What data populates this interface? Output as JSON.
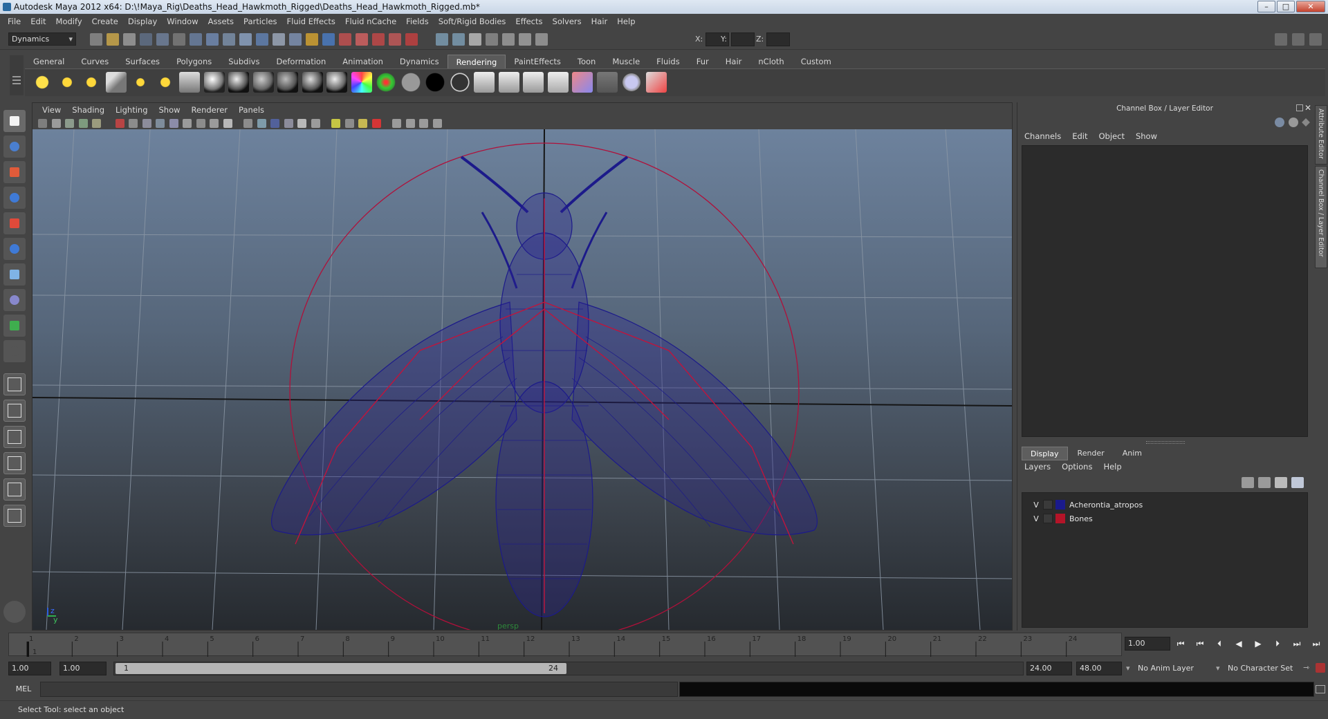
{
  "window": {
    "title": "Autodesk Maya 2012 x64: D:\\!Maya_Rig\\Deaths_Head_Hawkmoth_Rigged\\Deaths_Head_Hawkmoth_Rigged.mb*",
    "minimize_icon": "minimize-icon",
    "maximize_icon": "maximize-icon",
    "close_label": "✕"
  },
  "menubar": {
    "items": [
      "File",
      "Edit",
      "Modify",
      "Create",
      "Display",
      "Window",
      "Assets",
      "Particles",
      "Fluid Effects",
      "Fluid nCache",
      "Fields",
      "Soft/Rigid Bodies",
      "Effects",
      "Solvers",
      "Hair",
      "Help"
    ]
  },
  "statusline": {
    "menuset": "Dynamics",
    "x_label": "X:",
    "y_label": "Y:",
    "z_label": "Z:"
  },
  "shelf": {
    "tabs": [
      "General",
      "Curves",
      "Surfaces",
      "Polygons",
      "Subdivs",
      "Deformation",
      "Animation",
      "Dynamics",
      "Rendering",
      "PaintEffects",
      "Toon",
      "Muscle",
      "Fluids",
      "Fur",
      "Hair",
      "nCloth",
      "Custom"
    ],
    "active_tab": "Rendering"
  },
  "viewport": {
    "menu": [
      "View",
      "Shading",
      "Lighting",
      "Show",
      "Renderer",
      "Panels"
    ],
    "camera_label": "persp",
    "axis_labels": [
      "z",
      "y"
    ]
  },
  "channelbox": {
    "title": "Channel Box / Layer Editor",
    "menu": [
      "Channels",
      "Edit",
      "Object",
      "Show"
    ]
  },
  "layereditor": {
    "tabs": [
      "Display",
      "Render",
      "Anim"
    ],
    "active_tab": "Display",
    "menu": [
      "Layers",
      "Options",
      "Help"
    ],
    "layers": [
      {
        "visible": "V",
        "name": "Acherontia_atropos",
        "color": "#1a1a8c"
      },
      {
        "visible": "V",
        "name": "Bones",
        "color": "#b41428"
      }
    ]
  },
  "sidetabs": [
    "Attribute Editor",
    "Channel Box / Layer Editor"
  ],
  "timeline": {
    "frames": [
      "1",
      "2",
      "3",
      "4",
      "5",
      "6",
      "7",
      "8",
      "9",
      "10",
      "11",
      "12",
      "13",
      "14",
      "15",
      "16",
      "17",
      "18",
      "19",
      "20",
      "21",
      "22",
      "23",
      "24"
    ],
    "current_frame": "1",
    "current_time_field": "1.00"
  },
  "rangeslider": {
    "start_time": "1.00",
    "playback_start": "1.00",
    "range_start_label": "1",
    "range_end_label": "24",
    "playback_end": "24.00",
    "end_time": "48.00",
    "anim_layer": "No Anim Layer",
    "character_set": "No Character Set"
  },
  "commandline": {
    "language": "MEL"
  },
  "helpline": {
    "text": "Select Tool: select an object"
  },
  "colors": {
    "wireframe": "#1c1a8a",
    "bones": "#c0143c",
    "accent_timeline": "#c8c8c8"
  }
}
